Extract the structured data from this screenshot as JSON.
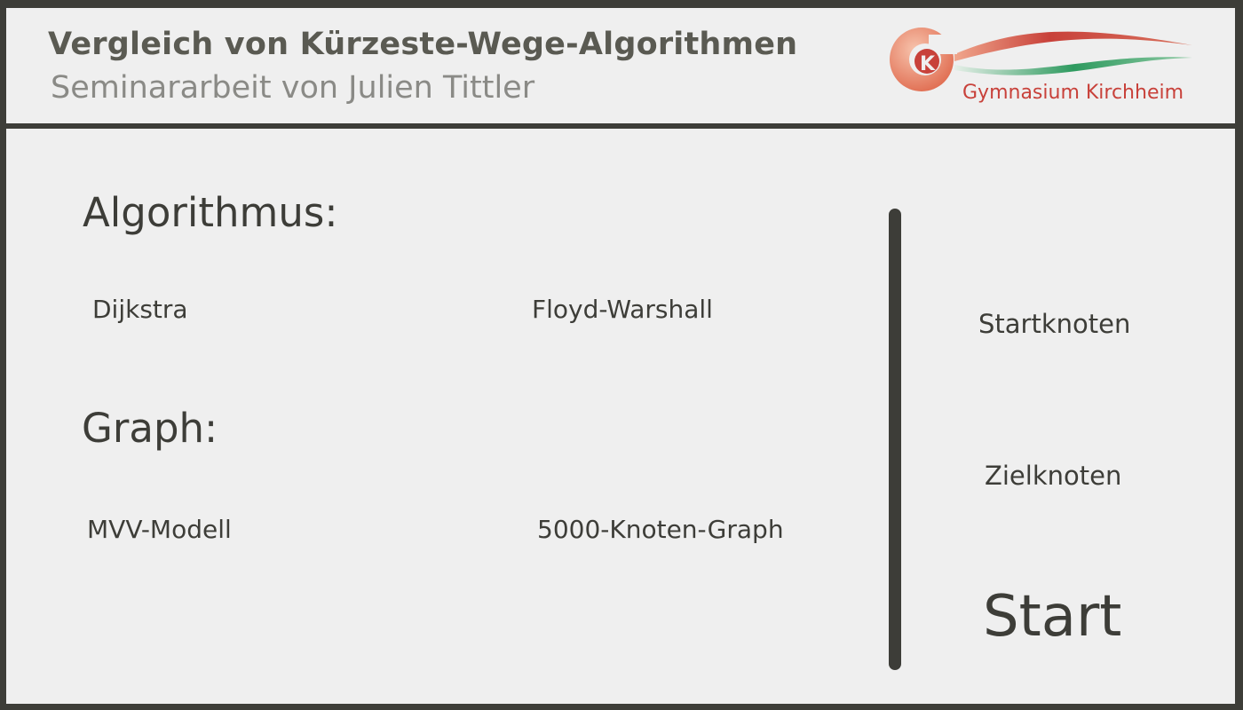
{
  "header": {
    "title": "Vergleich von Kürzeste-Wege-Algorithmen",
    "subtitle": "Seminararbeit von Julien Tittler",
    "logo_text": "Gymnasium Kirchheim"
  },
  "algorithm": {
    "heading": "Algorithmus:",
    "options": [
      "Dijkstra",
      "Floyd-Warshall"
    ]
  },
  "graph": {
    "heading": "Graph:",
    "options": [
      "MVV-Modell",
      "5000-Knoten-Graph"
    ]
  },
  "nodes": {
    "start_label": "Startknoten",
    "target_label": "Zielknoten"
  },
  "start_button": "Start",
  "colors": {
    "frame": "#3d3d38",
    "background": "#efefef",
    "title": "#5a5a52",
    "subtitle": "#8a8a86",
    "logo_red": "#c8413a",
    "logo_green": "#2e9a5f"
  }
}
